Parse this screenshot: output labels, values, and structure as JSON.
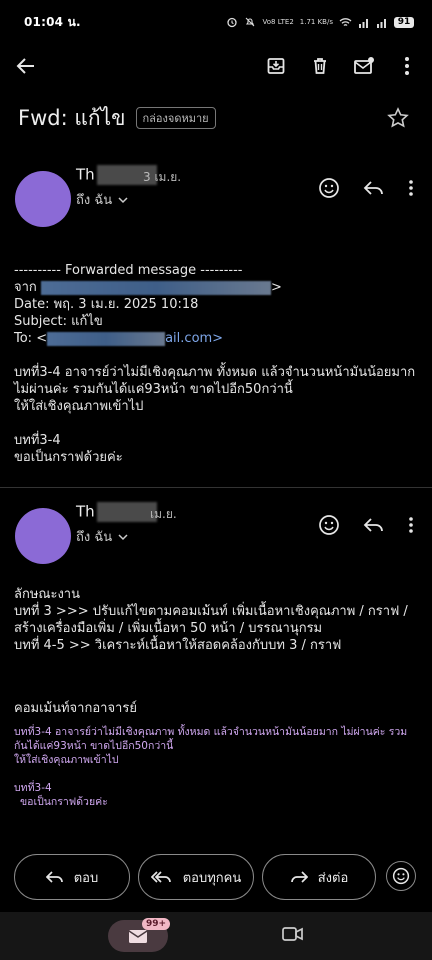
{
  "status": {
    "time": "01:04 น.",
    "network": "Vo8 LTE2",
    "speed": "1.71 KB/s",
    "battery": "91"
  },
  "toolbar": {
    "icons": [
      "back-arrow-icon",
      "archive-icon",
      "delete-icon",
      "mark-unread-icon",
      "more-icon"
    ]
  },
  "subject": {
    "title": "Fwd: แก้ไข",
    "label": "กล่องจดหมาย"
  },
  "message1": {
    "sender_initial": "Th",
    "date": "3 เม.ย.",
    "to": "ถึง ฉัน",
    "fwd_header": "---------- Forwarded message ---------",
    "from_label": "จาก",
    "from_tail": ">",
    "date_line": "Date: พฤ. 3 เม.ย. 2025 10:18",
    "subject_line": "Subject: แก้ไข",
    "to_label": "To: <",
    "to_tail": "ail.com>",
    "para1": "บทที่3-4 อาจารย์ว่าไม่มีเชิงคุณภาพ ทั้งหมด แล้วจำนวนหน้ามันน้อยมาก ไม่ผ่านค่ะ รวมกันได้แค่93หน้า ขาดไปอีก50กว่านี้",
    "para2": "ให้ใส่เชิงคุณภาพเข้าไป",
    "para3": "บทที่3-4",
    "para4": "ขอเป็นกราฟด้วยค่ะ"
  },
  "message2": {
    "sender_initial": "Th",
    "date": "เม.ย.",
    "to": "ถึง ฉัน",
    "line1": "ลักษณะงาน",
    "line2": "บทที่ 3 >>>  ปรับแก้ไขตามคอมเม้นท์  เพิ่มเนื้อหาเชิงคุณภาพ /  กราฟ / สร้างเครื่องมือเพิ่ม /  เพิ่มเนื้อหา 50 หน้า  /  บรรณานุกรม",
    "line3": "บทที่ 4-5  >> วิเคราะห์เนื้อหาให้สอดคล้องกับบท 3 / กราฟ",
    "comment_title": "คอมเม้นท์จากอาจารย์",
    "q1": "บทที่3-4  อาจารย์ว่าไม่มีเชิงคุณภาพ  ทั้งหมด  แล้วจำนวนหน้ามันน้อยมาก  ไม่ผ่านค่ะ  รวมกันได้แค่93หน้า  ขาดไปอีก50กว่านี้",
    "q2": "ให้ใส่เชิงคุณภาพเข้าไป",
    "q3": "บทที่3-4",
    "q4": "ขอเป็นกราฟด้วยค่ะ"
  },
  "actions": {
    "reply": "ตอบ",
    "reply_all": "ตอบทุกคน",
    "forward": "ส่งต่อ"
  },
  "nav": {
    "badge": "99+"
  }
}
